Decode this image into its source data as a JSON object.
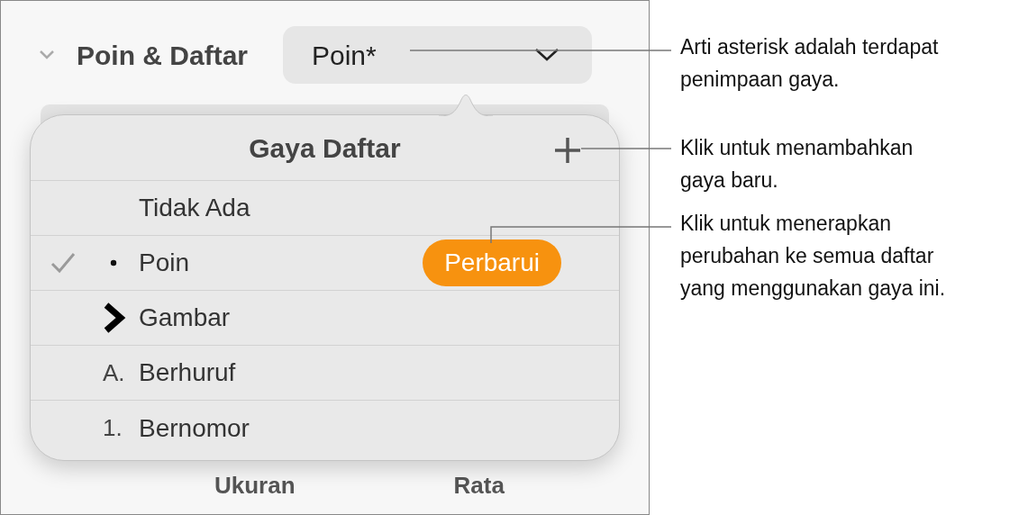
{
  "section": {
    "title": "Poin & Daftar",
    "expanded": true,
    "dropdown": {
      "value": "Poin*"
    }
  },
  "popover": {
    "title": "Gaya Daftar",
    "rows": [
      {
        "kind": "plain",
        "label": "Tidak Ada",
        "selected": false
      },
      {
        "kind": "bullet",
        "label": "Poin",
        "selected": true,
        "action": "Perbarui"
      },
      {
        "kind": "image",
        "label": "Gambar",
        "selected": false
      },
      {
        "kind": "text",
        "marker": "A.",
        "label": "Berhuruf",
        "selected": false
      },
      {
        "kind": "text",
        "marker": "1.",
        "label": "Bernomor",
        "selected": false
      }
    ]
  },
  "footer_labels": [
    "Ukuran",
    "Rata"
  ],
  "callouts": [
    {
      "text": "Arti asterisk adalah terdapat\npenimpaan gaya."
    },
    {
      "text": "Klik untuk menambahkan\ngaya baru."
    },
    {
      "text": "Klik untuk menerapkan\nperubahan ke semua daftar\nyang menggunakan gaya ini."
    }
  ]
}
